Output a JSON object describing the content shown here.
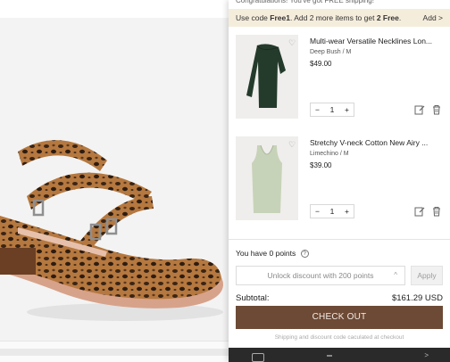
{
  "drawer": {
    "congrats_text": "Congratulations! You've got FREE shipping!",
    "promo": {
      "prefix": "Use code ",
      "code": "Free1",
      "middle": ". Add 2 more items to get ",
      "offer": "2 Free",
      "suffix": ".",
      "add_label": "Add >"
    },
    "items": [
      {
        "name": "Multi-wear Versatile Necklines Lon...",
        "variant": "Deep Bush / M",
        "price": "$49.00",
        "qty": "1",
        "minus": "−",
        "plus": "+"
      },
      {
        "name": "Stretchy V-neck Cotton New Airy ...",
        "variant": "Limechino / M",
        "price": "$39.00",
        "qty": "1",
        "minus": "−",
        "plus": "+"
      }
    ],
    "points_label": "You have 0 points",
    "points_help": "?",
    "unlock_label": "Unlock discount with 200 points",
    "unlock_chevron": "^",
    "apply_label": "Apply",
    "subtotal_label": "Subtotal:",
    "subtotal_value": "$161.29 USD",
    "checkout_label": "CHECK OUT",
    "shipping_note": "Shipping and discount code caculated at checkout"
  },
  "icons": {
    "wish": "heart-icon",
    "edit": "edit-icon",
    "trash": "trash-icon"
  },
  "colors": {
    "checkout_bg": "#6d4a35",
    "promo_bg": "#f5eddc",
    "item1_color": "#243b2b",
    "item2_color": "#c7d3b8"
  }
}
